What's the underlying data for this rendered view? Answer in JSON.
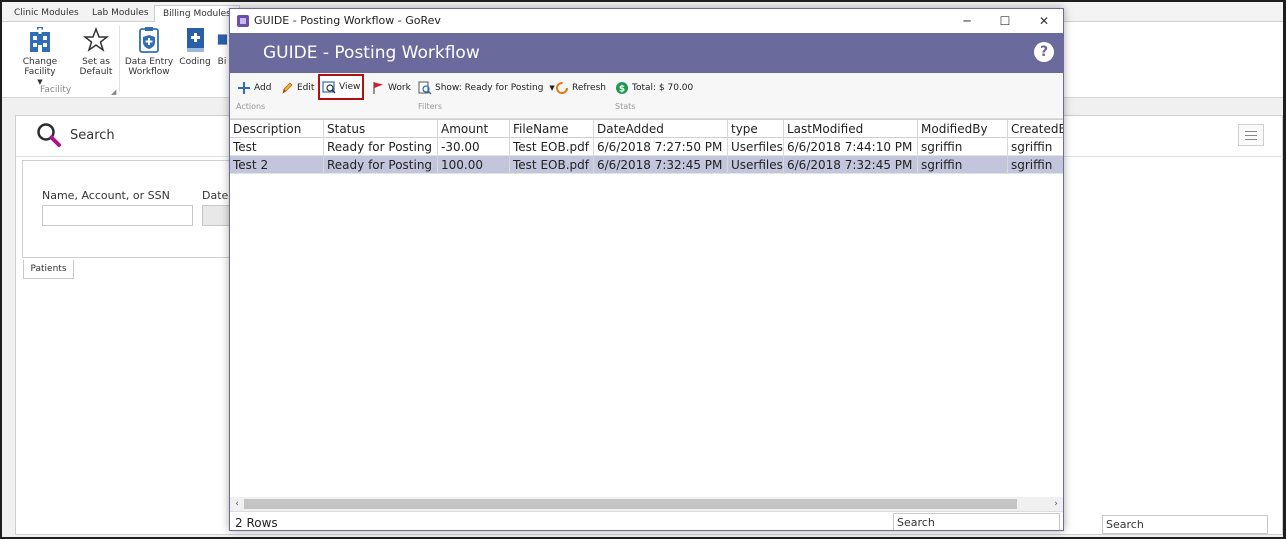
{
  "module_tabs": [
    "Clinic Modules",
    "Lab Modules",
    "Billing Modules"
  ],
  "ribbon": {
    "change_facility": "Change Facility",
    "set_as_default_1": "Set as",
    "set_as_default_2": "Default",
    "data_entry_1": "Data Entry",
    "data_entry_2": "Workflow",
    "coding": "Coding",
    "partial": "Bi",
    "group_label": "Facility"
  },
  "search_panel": {
    "title": "Search",
    "name_label": "Name, Account, or SSN",
    "date_label": "Date o",
    "patients_tab": "Patients",
    "bottom_search_placeholder": "Search"
  },
  "window": {
    "title": "GUIDE - Posting Workflow - GoRev",
    "header": "GUIDE - Posting Workflow",
    "help": "?",
    "controls": {
      "minimize": "─",
      "maximize": "☐",
      "close": "✕"
    },
    "toolbar": {
      "add": "Add",
      "edit": "Edit",
      "view": "View",
      "work": "Work",
      "show": "Show: Ready for Posting",
      "refresh": "Refresh",
      "total": "Total: $ 70.00",
      "sections": [
        "Actions",
        "Filters",
        "Stats"
      ]
    },
    "grid": {
      "columns": [
        "Description",
        "Status",
        "Amount",
        "FileName",
        "DateAdded",
        "type",
        "LastModified",
        "ModifiedBy",
        "CreatedB"
      ],
      "rows": [
        [
          "Test",
          "Ready for Posting",
          "-30.00",
          "Test EOB.pdf",
          "6/6/2018 7:27:50 PM",
          "Userfiles",
          "6/6/2018 7:44:10 PM",
          "sgriffin",
          "sgriffin"
        ],
        [
          "Test 2",
          "Ready for Posting",
          "100.00",
          "Test EOB.pdf",
          "6/6/2018 7:32:45 PM",
          "Userfiles",
          "6/6/2018 7:32:45 PM",
          "sgriffin",
          "sgriffin"
        ]
      ]
    },
    "status": {
      "rows": "2 Rows",
      "search_placeholder": "Search"
    }
  }
}
